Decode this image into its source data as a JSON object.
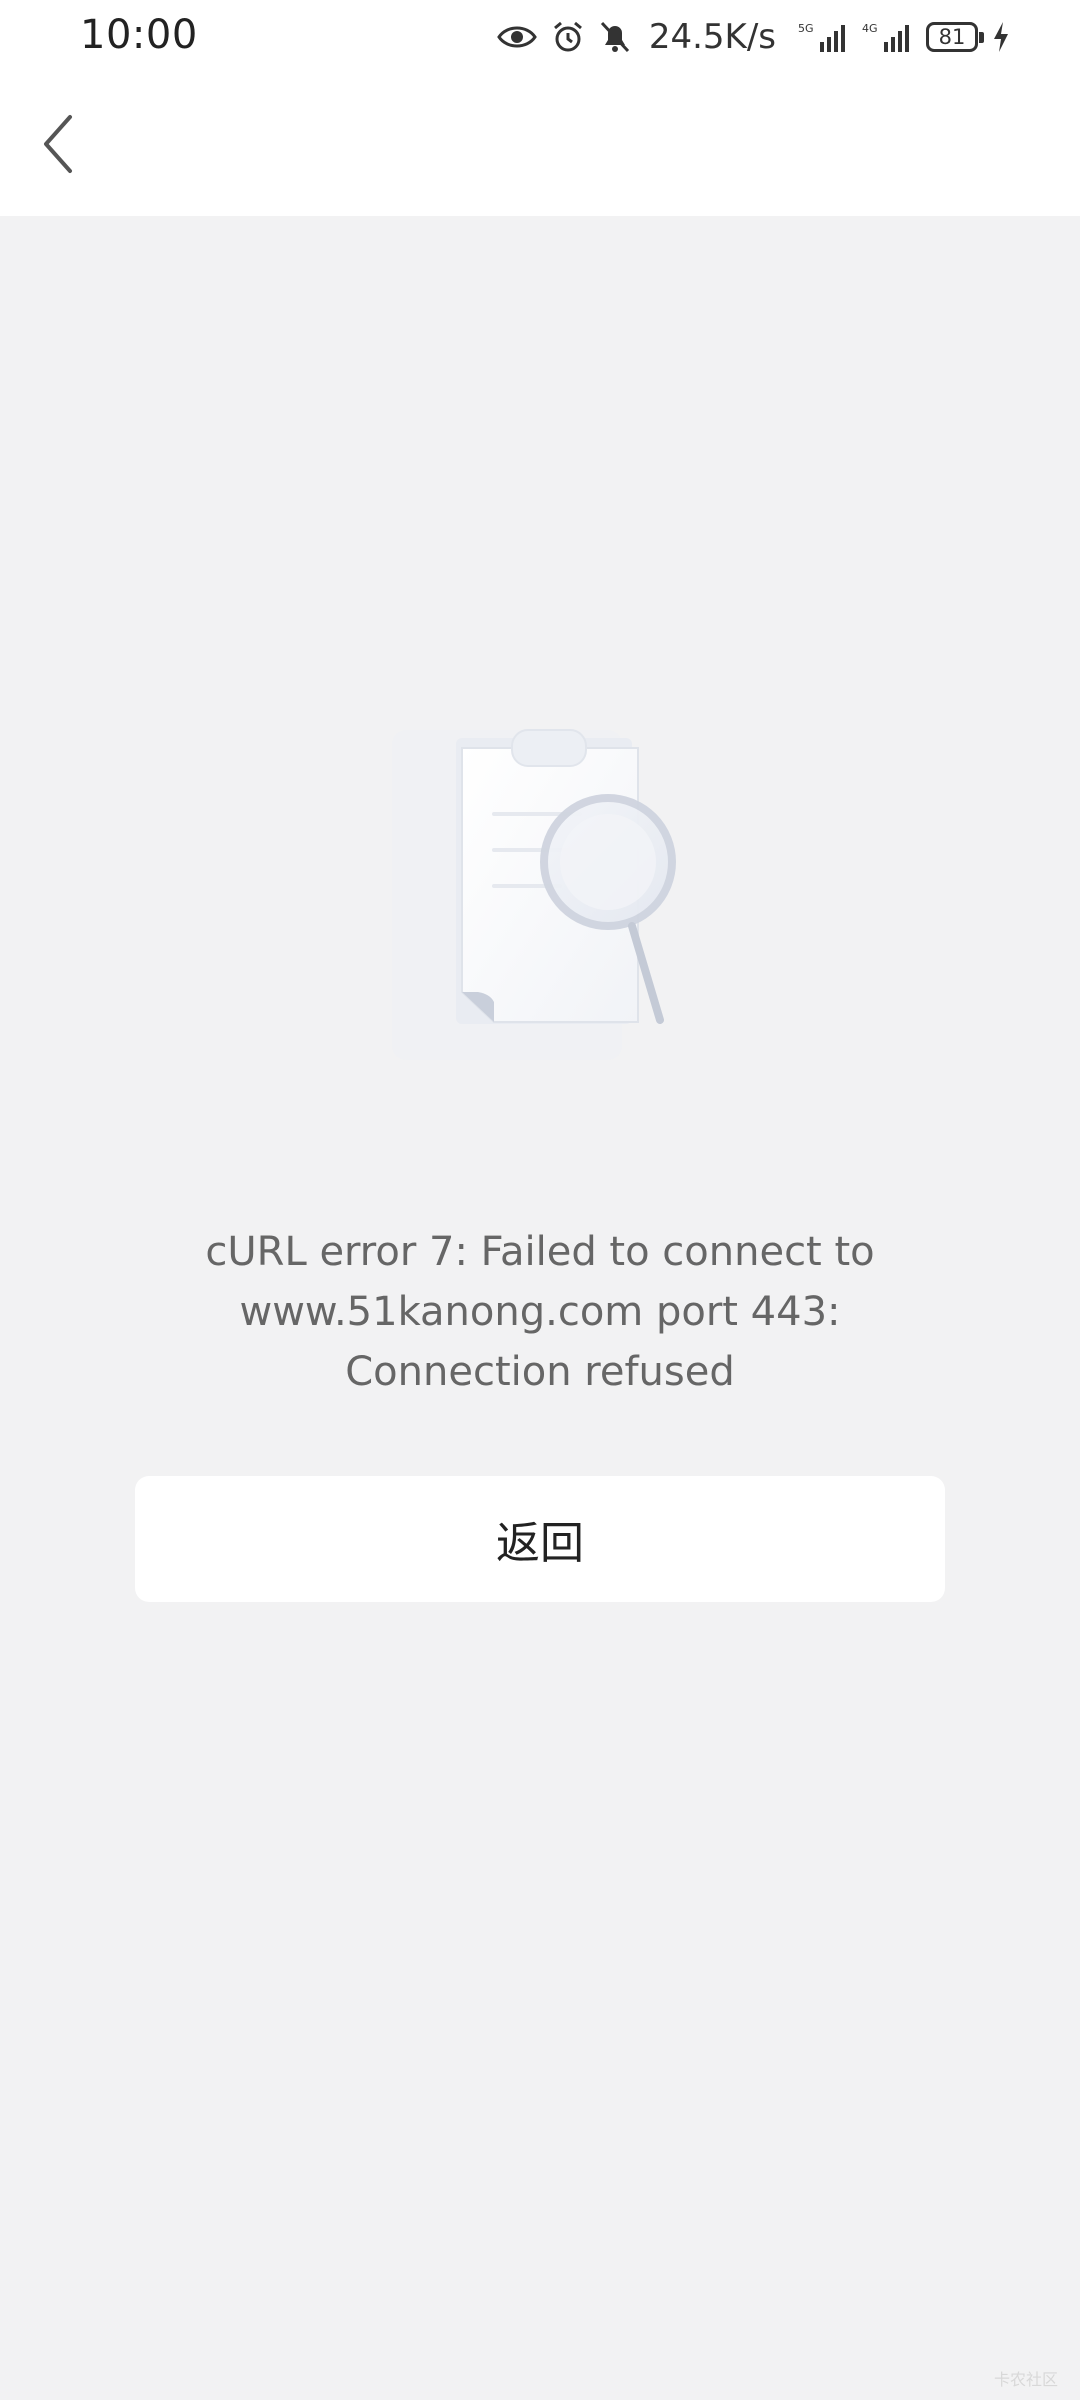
{
  "status_bar": {
    "time": "10:00",
    "net_speed": "24.5K/s",
    "signal_1_label": "5G",
    "signal_2_label": "4G",
    "battery_level": "81",
    "icons": [
      "eye-icon",
      "alarm-icon",
      "bell-off-icon",
      "signal-5g-icon",
      "signal-4g-icon",
      "battery-icon",
      "charging-icon"
    ]
  },
  "header": {
    "back_icon": "chevron-left-icon"
  },
  "empty_state": {
    "illustration": "clipboard-search-illustration",
    "error_lines": [
      "cURL error 7: Failed to connect to",
      "www.51kanong.com port 443:",
      "Connection refused"
    ],
    "return_label": "返回"
  },
  "watermark": "卡农社区"
}
